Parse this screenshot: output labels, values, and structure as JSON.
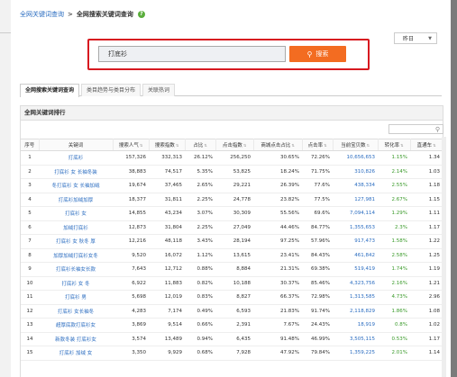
{
  "breadcrumb": {
    "root": "全网关键词查询",
    "separator": ">",
    "current": "全网搜索关键词查询",
    "help": "?"
  },
  "close_label": "×",
  "period_select": {
    "value": "昨日"
  },
  "search": {
    "value": "打底衫",
    "button_label": "搜索"
  },
  "tabs": [
    {
      "label": "全网搜索关键词查询",
      "active": true
    },
    {
      "label": "类目趋势与类目分布",
      "active": false
    },
    {
      "label": "关联热词",
      "active": false
    }
  ],
  "panel": {
    "title": "全网关键词排行"
  },
  "table": {
    "headers": [
      "序号",
      "关键词",
      "搜索人气",
      "搜索指数",
      "占比",
      "点击指数",
      "商城点击占比",
      "点击率",
      "当前宝贝数",
      "转化率",
      "直通车"
    ],
    "rows": [
      [
        "1",
        "打底衫",
        "157,326",
        "332,313",
        "26.12%",
        "256,250",
        "30.65%",
        "72.26%",
        "10,656,653",
        "1.15%",
        "1.34"
      ],
      [
        "2",
        "打底衫 女 长袖冬装",
        "38,883",
        "74,517",
        "5.35%",
        "53,825",
        "18.24%",
        "71.75%",
        "310,826",
        "2.14%",
        "1.03"
      ],
      [
        "3",
        "冬打底衫 女 长袖加绒",
        "19,674",
        "37,465",
        "2.65%",
        "29,221",
        "26.39%",
        "77.6%",
        "438,334",
        "2.55%",
        "1.18"
      ],
      [
        "4",
        "打底衫加绒加厚",
        "18,377",
        "31,811",
        "2.25%",
        "24,778",
        "23.82%",
        "77.5%",
        "127,981",
        "2.67%",
        "1.15"
      ],
      [
        "5",
        "打底衫 女",
        "14,855",
        "43,234",
        "3.07%",
        "30,309",
        "55.56%",
        "69.6%",
        "7,094,114",
        "1.29%",
        "1.11"
      ],
      [
        "6",
        "加绒打底衫",
        "12,873",
        "31,804",
        "2.25%",
        "27,049",
        "44.46%",
        "84.77%",
        "1,355,653",
        "2.3%",
        "1.17"
      ],
      [
        "7",
        "打底衫 女 秋冬 厚",
        "12,216",
        "48,118",
        "3.43%",
        "28,194",
        "97.25%",
        "57.96%",
        "917,473",
        "1.58%",
        "1.22"
      ],
      [
        "8",
        "加厚加绒打底衫女冬",
        "9,520",
        "16,072",
        "1.12%",
        "13,615",
        "23.41%",
        "84.43%",
        "461,842",
        "2.58%",
        "1.25"
      ],
      [
        "9",
        "打底衫长袖女长款",
        "7,643",
        "12,712",
        "0.88%",
        "8,884",
        "21.31%",
        "69.38%",
        "519,419",
        "1.74%",
        "1.19"
      ],
      [
        "10",
        "打底衫 女 冬",
        "6,922",
        "11,883",
        "0.82%",
        "10,188",
        "30.37%",
        "85.46%",
        "4,323,756",
        "2.16%",
        "1.21"
      ],
      [
        "11",
        "打底衫 男",
        "5,698",
        "12,019",
        "0.83%",
        "8,827",
        "66.37%",
        "72.98%",
        "1,313,585",
        "4.73%",
        "2.96"
      ],
      [
        "12",
        "打底衫 女长袖冬",
        "4,283",
        "7,174",
        "0.49%",
        "6,593",
        "21.83%",
        "91.74%",
        "2,118,829",
        "1.86%",
        "1.08"
      ],
      [
        "13",
        "超厚底款打底衫女",
        "3,869",
        "9,514",
        "0.66%",
        "2,391",
        "7.67%",
        "24.43%",
        "18,919",
        "0.8%",
        "1.02"
      ],
      [
        "14",
        "新款冬装 打底衫女",
        "3,574",
        "13,489",
        "0.94%",
        "6,435",
        "91.48%",
        "46.99%",
        "3,505,115",
        "0.53%",
        "1.17"
      ],
      [
        "15",
        "打底衫 加绒 女",
        "3,350",
        "9,929",
        "0.68%",
        "7,928",
        "47.92%",
        "79.84%",
        "1,359,225",
        "2.01%",
        "1.14"
      ]
    ]
  }
}
